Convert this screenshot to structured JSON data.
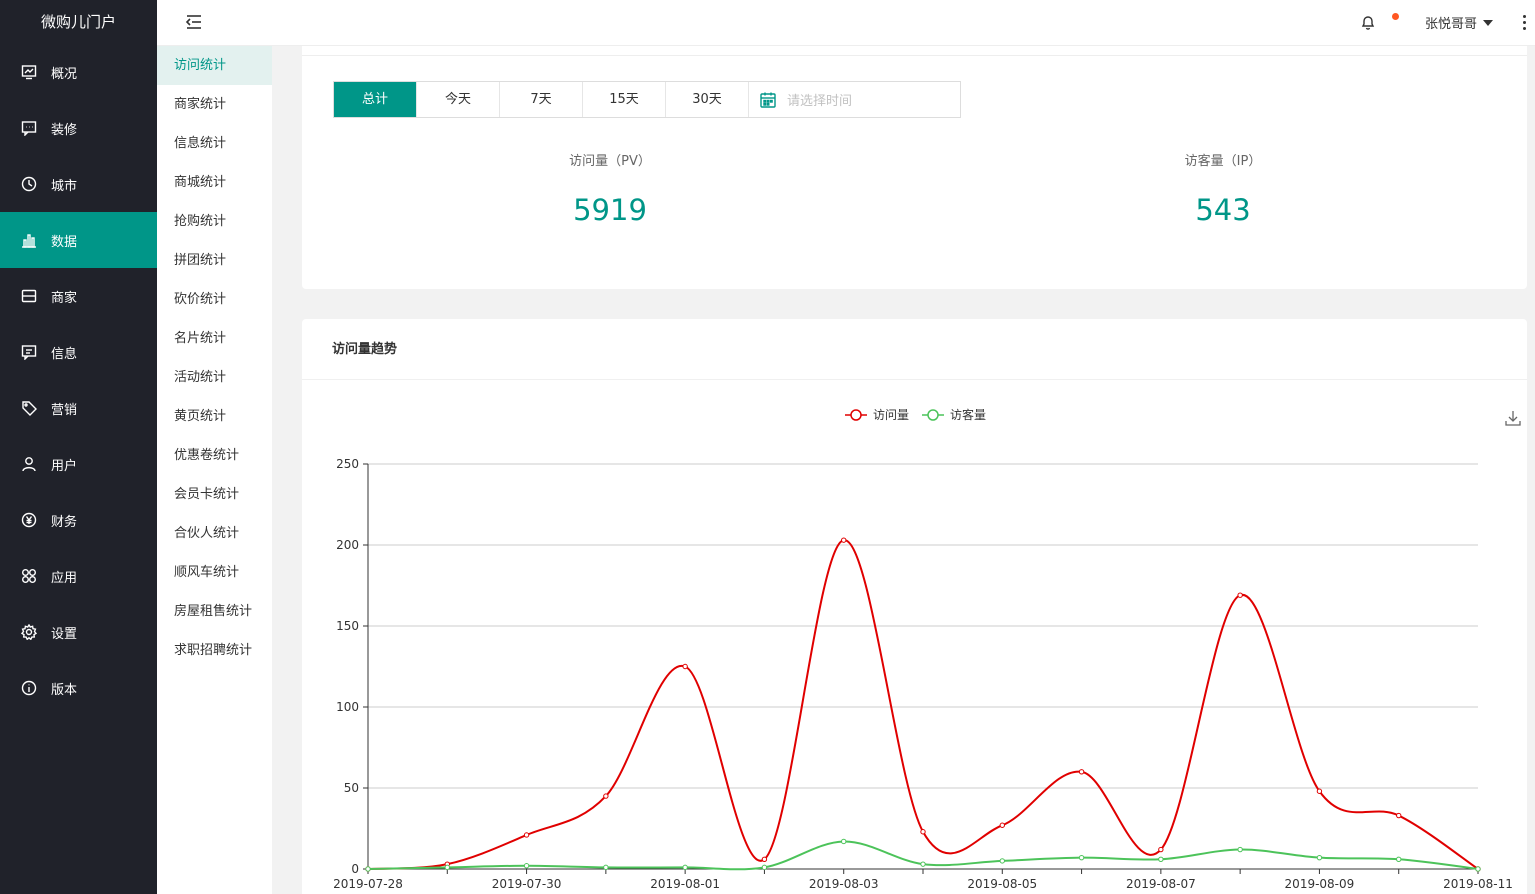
{
  "brand": "微购儿门户",
  "sidebar": {
    "items": [
      {
        "label": "概况",
        "icon": "monitor-icon",
        "active": false
      },
      {
        "label": "装修",
        "icon": "chat-icon",
        "active": false
      },
      {
        "label": "城市",
        "icon": "pie-icon",
        "active": false
      },
      {
        "label": "数据",
        "icon": "bar-chart-icon",
        "active": true
      },
      {
        "label": "商家",
        "icon": "store-icon",
        "active": false
      },
      {
        "label": "信息",
        "icon": "message-icon",
        "active": false
      },
      {
        "label": "营销",
        "icon": "tag-icon",
        "active": false
      },
      {
        "label": "用户",
        "icon": "user-icon",
        "active": false
      },
      {
        "label": "财务",
        "icon": "yen-icon",
        "active": false
      },
      {
        "label": "应用",
        "icon": "apps-icon",
        "active": false
      },
      {
        "label": "设置",
        "icon": "gear-icon",
        "active": false
      },
      {
        "label": "版本",
        "icon": "info-icon",
        "active": false
      }
    ]
  },
  "header": {
    "user_name": "张悦哥哥"
  },
  "subnav": {
    "items": [
      {
        "label": "访问统计",
        "active": true
      },
      {
        "label": "商家统计",
        "active": false
      },
      {
        "label": "信息统计",
        "active": false
      },
      {
        "label": "商城统计",
        "active": false
      },
      {
        "label": "抢购统计",
        "active": false
      },
      {
        "label": "拼团统计",
        "active": false
      },
      {
        "label": "砍价统计",
        "active": false
      },
      {
        "label": "名片统计",
        "active": false
      },
      {
        "label": "活动统计",
        "active": false
      },
      {
        "label": "黄页统计",
        "active": false
      },
      {
        "label": "优惠卷统计",
        "active": false
      },
      {
        "label": "会员卡统计",
        "active": false
      },
      {
        "label": "合伙人统计",
        "active": false
      },
      {
        "label": "顺风车统计",
        "active": false
      },
      {
        "label": "房屋租售统计",
        "active": false
      },
      {
        "label": "求职招聘统计",
        "active": false
      }
    ]
  },
  "filters": {
    "buttons": [
      "总计",
      "今天",
      "7天",
      "15天",
      "30天"
    ],
    "active_index": 0,
    "date_placeholder": "请选择时间"
  },
  "stats": {
    "pv_label": "访问量（PV）",
    "pv_value": "5919",
    "ip_label": "访客量（IP）",
    "ip_value": "543"
  },
  "trend": {
    "title": "访问量趋势"
  },
  "chart_data": {
    "type": "line",
    "x": [
      "2019-07-28",
      "2019-07-29",
      "2019-07-30",
      "2019-07-31",
      "2019-08-01",
      "2019-08-02",
      "2019-08-03",
      "2019-08-04",
      "2019-08-05",
      "2019-08-06",
      "2019-08-07",
      "2019-08-08",
      "2019-08-09",
      "2019-08-10",
      "2019-08-11"
    ],
    "x_tick_labels": [
      "2019-07-28",
      "2019-07-30",
      "2019-08-01",
      "2019-08-03",
      "2019-08-05",
      "2019-08-07",
      "2019-08-09",
      "2019-08-11"
    ],
    "series": [
      {
        "name": "访问量",
        "color": "#e00000",
        "values": [
          0,
          3,
          21,
          45,
          125,
          6,
          203,
          23,
          27,
          60,
          12,
          169,
          48,
          33,
          0
        ]
      },
      {
        "name": "访客量",
        "color": "#4cc35a",
        "values": [
          0,
          1,
          2,
          1,
          1,
          1,
          17,
          3,
          5,
          7,
          6,
          12,
          7,
          6,
          0
        ]
      }
    ],
    "ylim": [
      0,
      250
    ],
    "y_ticks": [
      0,
      50,
      100,
      150,
      200,
      250
    ],
    "legend": "top-center",
    "grid": true
  }
}
